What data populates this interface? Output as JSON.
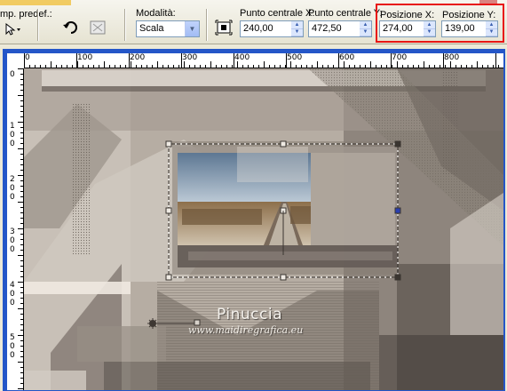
{
  "toolbar": {
    "preset_label": "mp. predef.:",
    "mode": {
      "label": "Modalità:",
      "selected": "Scala"
    },
    "center_x": {
      "label": "Punto centrale X:",
      "value": "240,00"
    },
    "center_y": {
      "label": "Punto centrale Y:",
      "value": "472,50"
    },
    "pos_x": {
      "label": "Posizione X:",
      "value": "274,00"
    },
    "pos_y": {
      "label": "Posizione Y:",
      "value": "139,00"
    },
    "icons": [
      "preset-pick-icon",
      "rotate-icon",
      "fit-icon",
      "move-to-center-icon"
    ]
  },
  "ruler_h_labels": [
    "0",
    "100",
    "200",
    "300",
    "400",
    "500",
    "600",
    "700",
    "800"
  ],
  "ruler_v_labels": [
    "0",
    "1 0 0",
    "2 0 0",
    "3 0 0",
    "4 0 0",
    "5 0 0"
  ],
  "watermark": {
    "title": "Pinuccia",
    "url": "www.maidiregrafica.eu"
  },
  "colors": {
    "window_border": "#2456c8",
    "highlight": "#e81515",
    "canvas_tone": "#9e958c"
  }
}
